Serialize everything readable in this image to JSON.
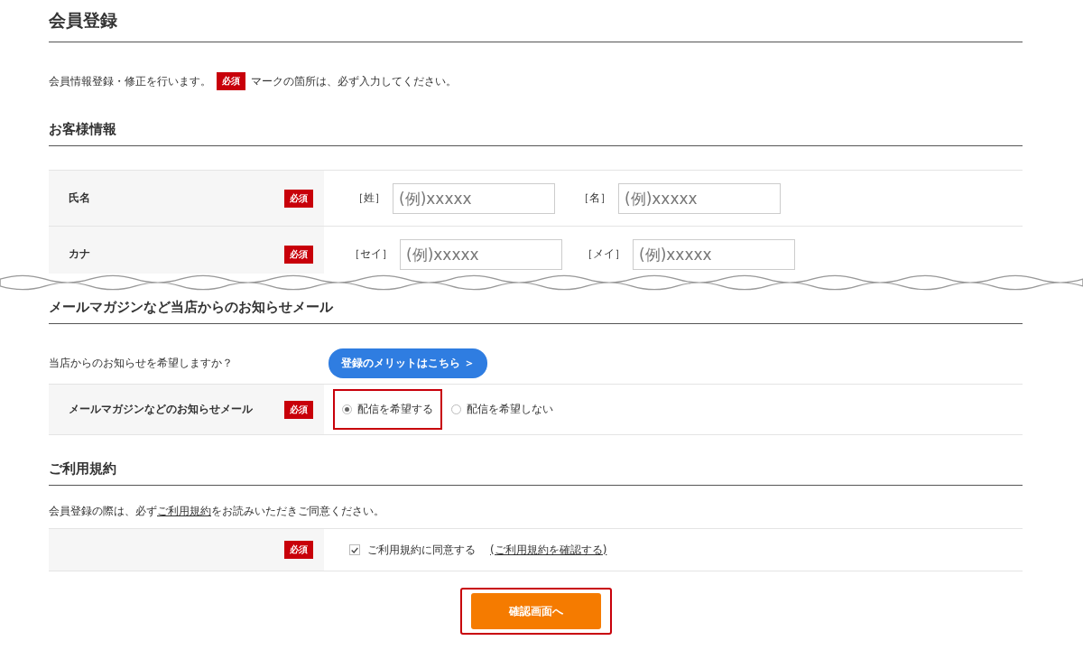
{
  "page_title": "会員登録",
  "intro": {
    "before": "会員情報登録・修正を行います。",
    "badge": "必須",
    "after": "マークの箇所は、必ず入力してください。"
  },
  "customer_info": {
    "heading": "お客様情報",
    "rows": [
      {
        "label": "氏名",
        "badge": "必須",
        "fields": [
          {
            "prefix": "［姓］",
            "placeholder": "(例)xxxxx"
          },
          {
            "prefix": "［名］",
            "placeholder": "(例)xxxxx"
          }
        ]
      },
      {
        "label": "カナ",
        "badge": "必須",
        "fields": [
          {
            "prefix": "［セイ］",
            "placeholder": "(例)xxxxx"
          },
          {
            "prefix": "［メイ］",
            "placeholder": "(例)xxxxx"
          }
        ]
      }
    ]
  },
  "newsletter": {
    "heading": "メールマガジンなど当店からのお知らせメール",
    "question": {
      "label": "当店からのお知らせを希望しますか？",
      "button": "登録のメリットはこちら ＞"
    },
    "choice": {
      "label": "メールマガジンなどのお知らせメール",
      "badge": "必須",
      "options": [
        {
          "label": "配信を希望する",
          "selected": true,
          "highlighted": true
        },
        {
          "label": "配信を希望しない",
          "selected": false,
          "highlighted": false
        }
      ]
    }
  },
  "terms": {
    "heading": "ご利用規約",
    "note": {
      "before": "会員登録の際は、必ず",
      "link": "ご利用規約",
      "after": "をお読みいただきご同意ください。"
    },
    "row": {
      "badge": "必須",
      "checkbox": {
        "label": "ご利用規約に同意する",
        "checked": true
      },
      "link": "(ご利用規約を確認する)"
    }
  },
  "submit": {
    "label": "確認画面へ",
    "highlighted": true
  }
}
